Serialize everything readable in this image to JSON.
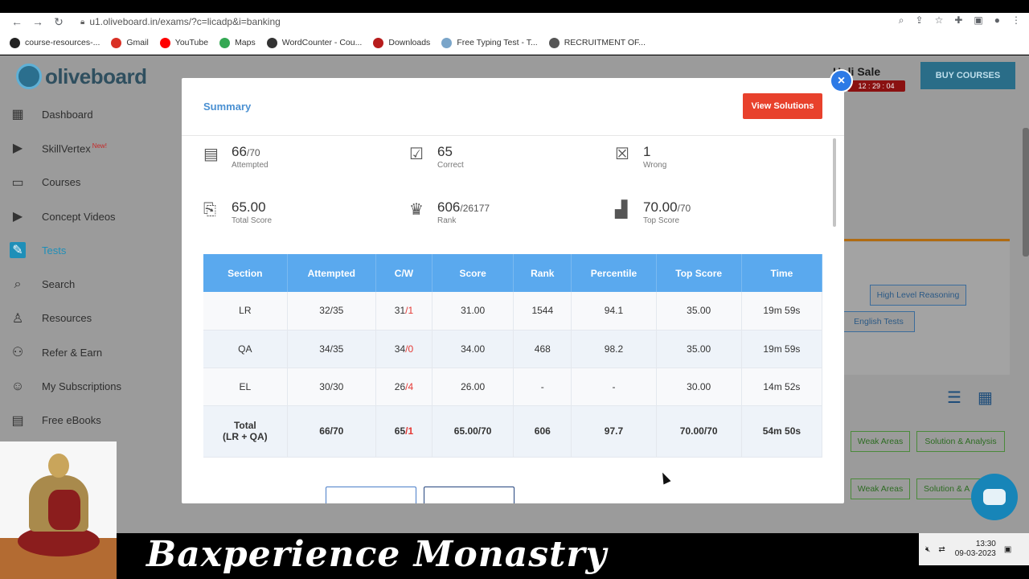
{
  "browser": {
    "url": "u1.oliveboard.in/exams/?c=licadp&i=banking",
    "bookmarks": [
      {
        "label": "course-resources-...",
        "icon": "github-icon",
        "color": "#222222"
      },
      {
        "label": "Gmail",
        "icon": "gmail-icon",
        "color": "#d93025"
      },
      {
        "label": "YouTube",
        "icon": "youtube-icon",
        "color": "#ff0000"
      },
      {
        "label": "Maps",
        "icon": "maps-icon",
        "color": "#34a853"
      },
      {
        "label": "WordCounter - Cou...",
        "icon": "wordcounter-icon",
        "color": "#333333"
      },
      {
        "label": "Downloads",
        "icon": "downloads-icon",
        "color": "#b71c1c"
      },
      {
        "label": "Free Typing Test - T...",
        "icon": "typing-icon",
        "color": "#7aa5c9"
      },
      {
        "label": "RECRUITMENT OF...",
        "icon": "globe-icon",
        "color": "#555555"
      }
    ]
  },
  "app": {
    "logo_text": "oliveboard",
    "holi_sale": "Holi Sale",
    "timer": "12 : 29 : 04",
    "buy_courses": "BUY COURSES"
  },
  "sidebar": {
    "items": [
      {
        "label": "Dashboard",
        "icon": "dashboard-icon",
        "glyph": "▦"
      },
      {
        "label": "SkillVertex",
        "badge": "New!",
        "icon": "video-icon",
        "glyph": "▶"
      },
      {
        "label": "Courses",
        "icon": "monitor-icon",
        "glyph": "▭"
      },
      {
        "label": "Concept Videos",
        "icon": "video-icon",
        "glyph": "▶"
      },
      {
        "label": "Tests",
        "icon": "pencil-icon",
        "glyph": "✎",
        "active": true
      },
      {
        "label": "Search",
        "icon": "search-icon",
        "glyph": "⌕"
      },
      {
        "label": "Resources",
        "icon": "resources-icon",
        "glyph": "♙"
      },
      {
        "label": "Refer & Earn",
        "icon": "refer-icon",
        "glyph": "⚇"
      },
      {
        "label": "My Subscriptions",
        "icon": "user-icon",
        "glyph": "☺"
      },
      {
        "label": "Free eBooks",
        "icon": "ebook-icon",
        "glyph": "▤"
      }
    ]
  },
  "background": {
    "tags": [
      "High Level Reasoning",
      "English Tests"
    ],
    "row_buttons": [
      "Weak Areas",
      "Solution & Analysis",
      "Weak Areas",
      "Solution & A"
    ]
  },
  "modal": {
    "title": "Summary",
    "view_solutions": "View Solutions",
    "close_label": "×",
    "stats": [
      {
        "value": "66",
        "total": "/70",
        "label": "Attempted",
        "icon": "attempted-icon"
      },
      {
        "value": "65",
        "total": "",
        "label": "Correct",
        "icon": "correct-icon"
      },
      {
        "value": "1",
        "total": "",
        "label": "Wrong",
        "icon": "wrong-icon"
      },
      {
        "value": "65.00",
        "total": "",
        "label": "Total Score",
        "icon": "certificate-icon"
      },
      {
        "value": "606",
        "total": "/26177",
        "label": "Rank",
        "icon": "trophy-icon"
      },
      {
        "value": "70.00",
        "total": "/70",
        "label": "Top Score",
        "icon": "podium-icon"
      }
    ],
    "table": {
      "headers": [
        "Section",
        "Attempted",
        "C/W",
        "Score",
        "Rank",
        "Percentile",
        "Top Score",
        "Time"
      ],
      "rows": [
        {
          "section": "LR",
          "attempted": "32/35",
          "correct": "31",
          "wrong": "/1",
          "score": "31.00",
          "rank": "1544",
          "percentile": "94.1",
          "top": "35.00",
          "time": "19m 59s"
        },
        {
          "section": "QA",
          "attempted": "34/35",
          "correct": "34",
          "wrong": "/0",
          "score": "34.00",
          "rank": "468",
          "percentile": "98.2",
          "top": "35.00",
          "time": "19m 59s"
        },
        {
          "section": "EL",
          "attempted": "30/30",
          "correct": "26",
          "wrong": "/4",
          "score": "26.00",
          "rank": "-",
          "percentile": "-",
          "top": "30.00",
          "time": "14m 52s"
        }
      ],
      "total": {
        "section_line1": "Total",
        "section_line2": "(LR + QA)",
        "attempted": "66/70",
        "correct": "65",
        "wrong": "/1",
        "score": "65.00/70",
        "rank": "606",
        "percentile": "97.7",
        "top": "70.00/70",
        "time": "54m 50s"
      }
    }
  },
  "footer": {
    "brand": "Baxperience Monastry",
    "time": "13:30",
    "date": "09-03-2023"
  },
  "colors": {
    "accent": "#5aa9ee",
    "danger": "#e8412c",
    "primary_nav": "#1f8fb8"
  }
}
